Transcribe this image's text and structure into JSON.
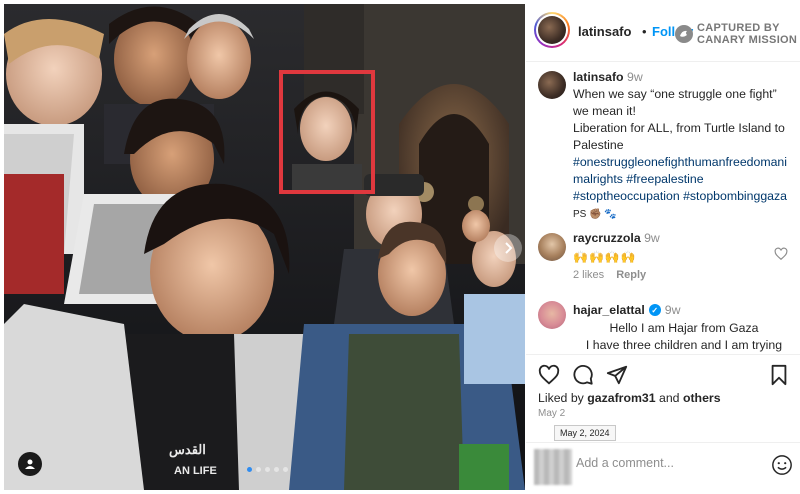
{
  "post": {
    "username": "latinsafo",
    "follow_label": "Follow",
    "separator": "•",
    "watermark": "CAPTURED BY\nCANARY MISSION",
    "watermark_line1": "CAPTURED BY",
    "watermark_line2": "CANARY MISSION",
    "caption": {
      "username": "latinsafo",
      "time": "9w",
      "text_lines": [
        "When we say “one struggle one fight”",
        "we mean it!",
        "Liberation for ALL, from Turtle Island to",
        "Palestine"
      ],
      "hashtags_lines": [
        "#onestruggleonefighthumanfreedomani",
        "malrights #freepalestine",
        "#stoptheoccupation #stopbombinggaza"
      ],
      "ps": "PS ✊🏽 🐾"
    },
    "comments": [
      {
        "username": "raycruzzola",
        "time": "9w",
        "text": "🙌🙌🙌🙌",
        "likes": "2 likes",
        "reply_label": "Reply"
      },
      {
        "username": "hajar_elattal",
        "time": "9w",
        "verified_mark": "✓",
        "text_lines": [
          "Hello I am Hajar from Gaza",
          "I have three children and I am trying"
        ]
      }
    ],
    "liked_by": {
      "prefix": "Liked by",
      "user": "gazafrom31",
      "and": "and",
      "others": "others"
    },
    "date": "May 2",
    "tooltip": "May 2, 2024",
    "add_comment_placeholder": "Add a comment...",
    "carousel_count": 5,
    "carousel_active": 0
  },
  "colors": {
    "accent": "#0095f6",
    "highlight": "#e0383e",
    "hashtag": "#00376b",
    "muted": "#8e8e8e"
  },
  "icons": [
    "heart-icon",
    "comment-icon",
    "share-icon",
    "bookmark-icon",
    "emoji-icon",
    "user-tag-icon",
    "next-arrow-icon",
    "verified-icon",
    "canary-logo-icon"
  ]
}
